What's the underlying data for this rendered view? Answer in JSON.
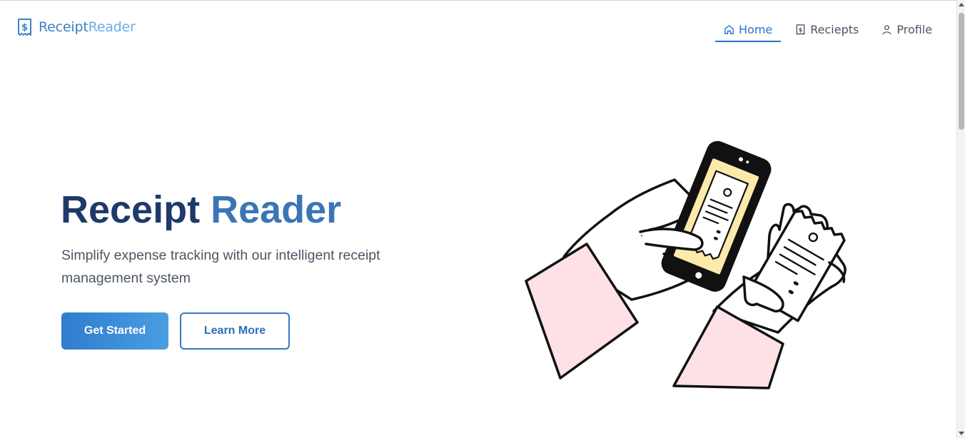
{
  "brand": {
    "part1": "Receipt",
    "part2": "Reader",
    "icon": "receipt-dollar-icon"
  },
  "nav": {
    "items": [
      {
        "label": "Home",
        "icon": "home-icon",
        "active": true
      },
      {
        "label": "Reciepts",
        "icon": "receipt-icon",
        "active": false
      },
      {
        "label": "Profile",
        "icon": "user-icon",
        "active": false
      }
    ]
  },
  "hero": {
    "title_part1": "Receipt",
    "title_part2": "Reader",
    "subtitle": "Simplify expense tracking with our intelligent receipt management system",
    "primary_button": "Get Started",
    "secondary_button": "Learn More",
    "illustration": "hands-holding-phone-scanning-receipt"
  },
  "colors": {
    "accent": "#2b6fd6",
    "title_dark": "#1e3a6a",
    "title_light": "#3a76b5",
    "sleeve_pink": "#fde1e4",
    "phone_screen": "#fbeaa9"
  }
}
